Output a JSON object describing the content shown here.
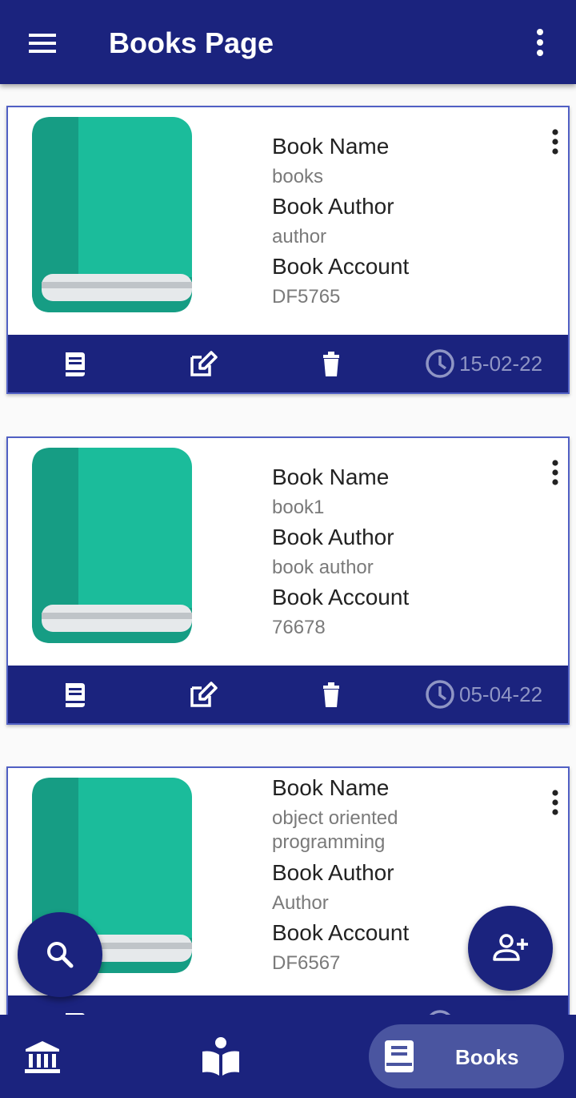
{
  "appbar": {
    "title": "Books Page"
  },
  "labels": {
    "name": "Book Name",
    "author": "Book Author",
    "account": "Book Account"
  },
  "books": [
    {
      "name": "books",
      "author": "author",
      "account": "DF5765",
      "date": "15-02-22"
    },
    {
      "name": "book1",
      "author": "book author",
      "account": "76678",
      "date": "05-04-22"
    },
    {
      "name": "object oriented programming",
      "name_lines": [
        "object oriented",
        "programming"
      ],
      "author": "Author",
      "account": "DF6567",
      "date": ""
    }
  ],
  "bottom_nav": {
    "books_label": "Books"
  },
  "colors": {
    "primary": "#1b237e",
    "accent_green": "#1bbc9b",
    "spine_green": "#169d84",
    "nav_active": "#4a55a0",
    "date_text": "#8f95c4"
  }
}
